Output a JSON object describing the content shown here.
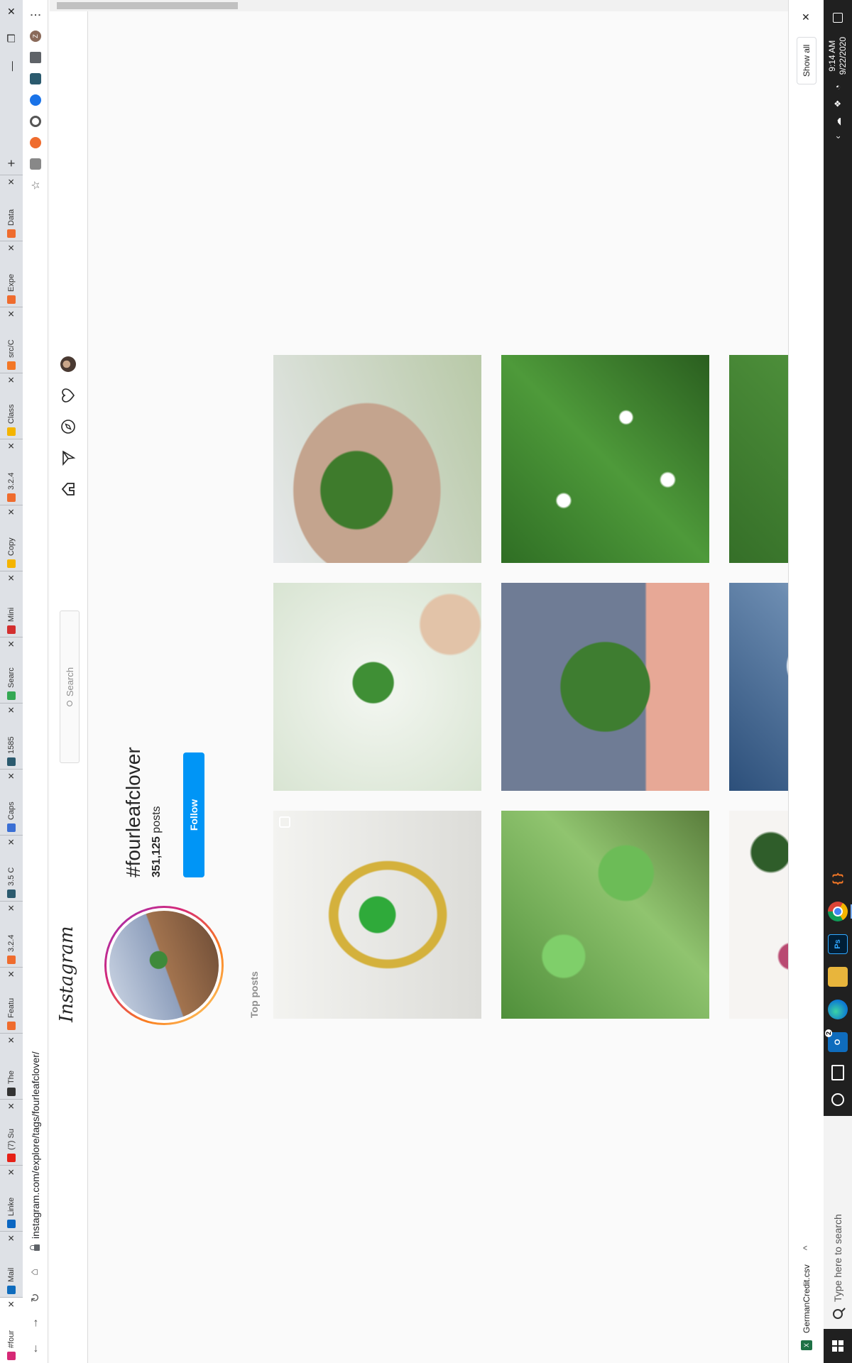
{
  "taskbar": {
    "search_placeholder": "Type here to search",
    "time": "9:14 AM",
    "date": "9/22/2020",
    "outlook_badge": "2"
  },
  "tabs": [
    {
      "label": "#four",
      "color": "#d62976"
    },
    {
      "label": "Mail",
      "color": "#0f6cbd"
    },
    {
      "label": "Linke",
      "color": "#0a66c2"
    },
    {
      "label": "(7) Su",
      "color": "#e62117"
    },
    {
      "label": "The",
      "color": "#333333"
    },
    {
      "label": "Featu",
      "color": "#ef6c2e"
    },
    {
      "label": "3.2.4",
      "color": "#ef6c2e"
    },
    {
      "label": "3.5 C",
      "color": "#2b5a6e"
    },
    {
      "label": "Caps",
      "color": "#3b6fd4"
    },
    {
      "label": "1585",
      "color": "#2b5a6e"
    },
    {
      "label": "Searc",
      "color": "#34a853"
    },
    {
      "label": "Mini",
      "color": "#d32f2f"
    },
    {
      "label": "Copy",
      "color": "#f4b400"
    },
    {
      "label": "3.2.4",
      "color": "#ef6c2e"
    },
    {
      "label": "Class",
      "color": "#f4b400"
    },
    {
      "label": "src/C",
      "color": "#f37726"
    },
    {
      "label": "Expe",
      "color": "#ef6c2e"
    },
    {
      "label": "Data",
      "color": "#ef6c2e"
    }
  ],
  "browser": {
    "url": "instagram.com/explore/tags/fourleafclover/"
  },
  "instagram": {
    "logo": "Instagram",
    "search_placeholder": "Search",
    "hashtag": "#fourleafclover",
    "post_count": "351,125",
    "post_count_suffix": "posts",
    "follow_label": "Follow",
    "section_label": "Top posts"
  },
  "downloads": {
    "file_name": "GermanCredit.csv",
    "show_all": "Show all"
  }
}
